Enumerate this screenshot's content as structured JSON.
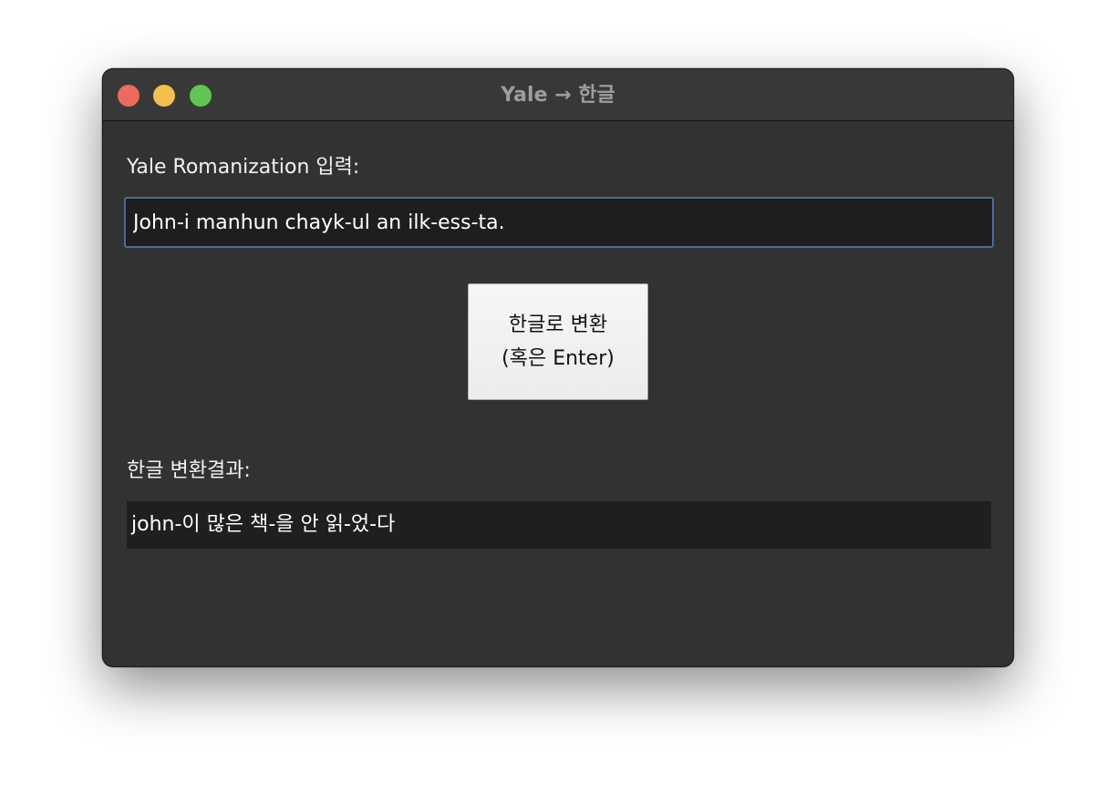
{
  "window": {
    "title": "Yale → 한글"
  },
  "input": {
    "label": "Yale Romanization 입력:",
    "value": "John-i manhun chayk-ul an ilk-ess-ta."
  },
  "convert_button": {
    "line1": "한글로 변환",
    "line2": "(혹은 Enter)"
  },
  "result": {
    "label": "한글 변환결과:",
    "value": "john-이 많은 책-을 안 읽-었-다"
  },
  "colors": {
    "window_bg": "#323232",
    "titlebar_bg": "#383838",
    "close": "#ec6a5e",
    "minimize": "#f4bf4f",
    "maximize": "#61c554",
    "focus_ring": "#4c6b9a"
  },
  "icons": {
    "close": "close-traffic-light-icon",
    "minimize": "minimize-traffic-light-icon",
    "maximize": "maximize-traffic-light-icon"
  }
}
